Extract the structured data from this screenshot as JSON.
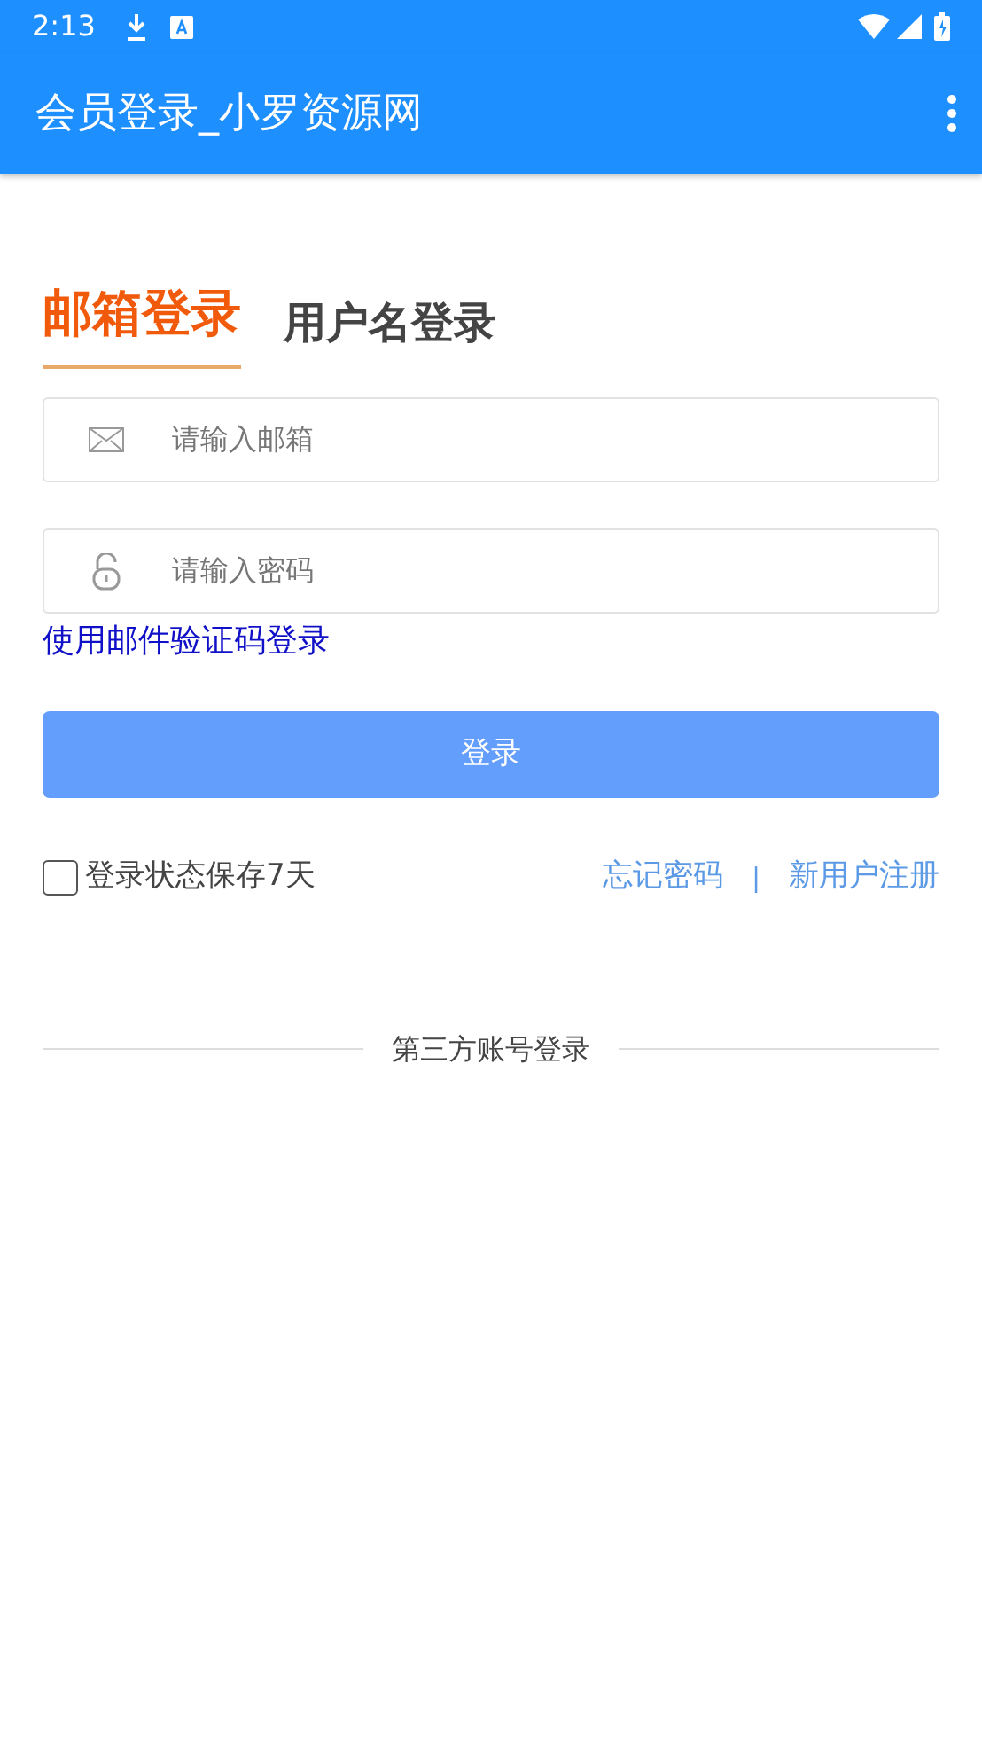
{
  "status_bar": {
    "time": "2:13"
  },
  "app_bar": {
    "title": "会员登录_小罗资源网"
  },
  "tabs": [
    {
      "label": "邮箱登录",
      "selected": true
    },
    {
      "label": "用户名登录",
      "selected": false
    }
  ],
  "fields": [
    {
      "kind": "email",
      "placeholder": "请输入邮箱"
    },
    {
      "kind": "password",
      "placeholder": "请输入密码"
    }
  ],
  "code_login_link": "使用邮件验证码登录",
  "login_button": "登录",
  "remember": {
    "label": "登录状态保存7天",
    "checked": false
  },
  "links": [
    "忘记密码",
    "新用户注册"
  ],
  "link_separator": "|",
  "third_party": "第三方账号登录"
}
